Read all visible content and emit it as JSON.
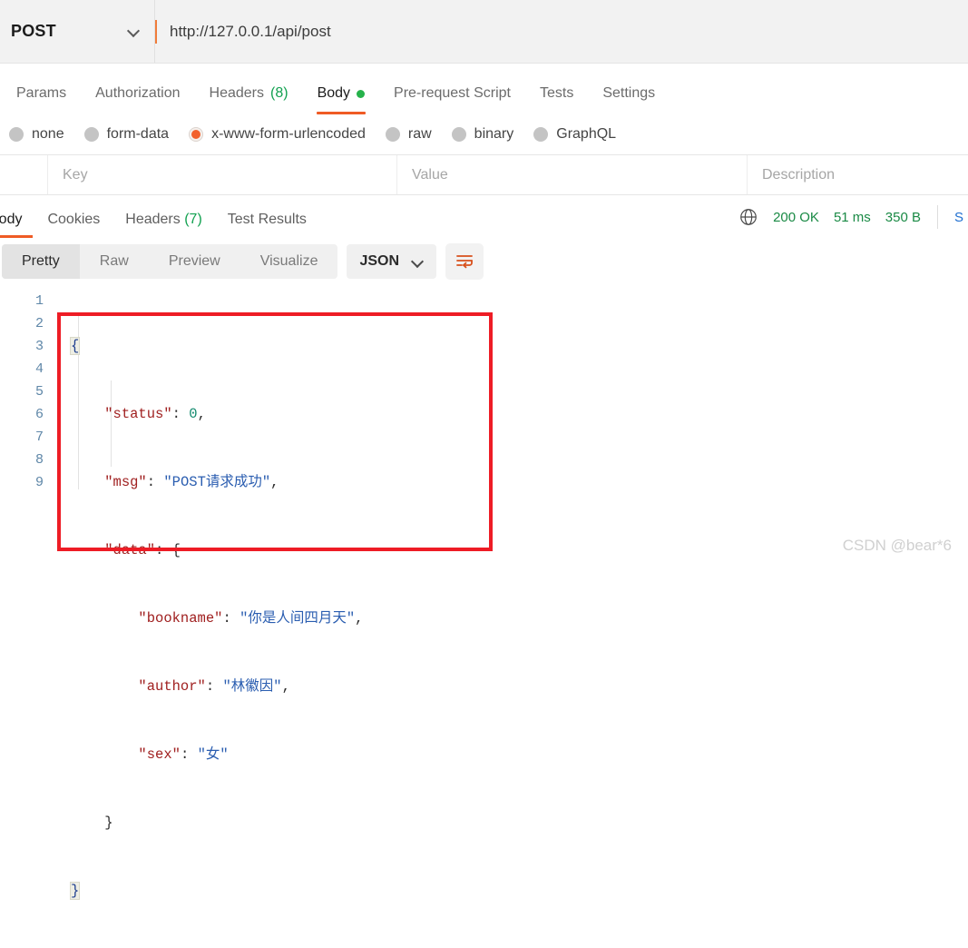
{
  "request_bar": {
    "method": "POST",
    "method_icon": "chevron-down-icon",
    "url": "http://127.0.0.1/api/post"
  },
  "request_tabs": [
    {
      "label": "Params",
      "active": false,
      "count": ""
    },
    {
      "label": "Authorization",
      "active": false,
      "count": ""
    },
    {
      "label": "Headers",
      "active": false,
      "count": "(8)"
    },
    {
      "label": "Body",
      "active": true,
      "count": ""
    },
    {
      "label": "Pre-request Script",
      "active": false,
      "count": ""
    },
    {
      "label": "Tests",
      "active": false,
      "count": ""
    },
    {
      "label": "Settings",
      "active": false,
      "count": ""
    }
  ],
  "body_types": [
    {
      "label": "none",
      "checked": false
    },
    {
      "label": "form-data",
      "checked": false
    },
    {
      "label": "x-www-form-urlencoded",
      "checked": true
    },
    {
      "label": "raw",
      "checked": false
    },
    {
      "label": "binary",
      "checked": false
    },
    {
      "label": "GraphQL",
      "checked": false
    }
  ],
  "param_table": {
    "columns": [
      "Key",
      "Value",
      "Description"
    ],
    "rows": []
  },
  "response_tabs": [
    {
      "label": "Body",
      "active": true,
      "count": ""
    },
    {
      "label": "Cookies",
      "active": false,
      "count": ""
    },
    {
      "label": "Headers",
      "active": false,
      "count": "(7)"
    },
    {
      "label": "Test Results",
      "active": false,
      "count": ""
    }
  ],
  "response_status": {
    "globe_icon": "globe-icon",
    "status": "200 OK",
    "time": "51 ms",
    "size": "350 B",
    "save_response": "S"
  },
  "view_toolbar": {
    "views": [
      {
        "label": "Pretty",
        "active": true
      },
      {
        "label": "Raw",
        "active": false
      },
      {
        "label": "Preview",
        "active": false
      },
      {
        "label": "Visualize",
        "active": false
      }
    ],
    "format": "JSON",
    "format_icon": "chevron-down-icon",
    "wrap_icon": "word-wrap-icon"
  },
  "code": {
    "line_numbers": [
      "1",
      "2",
      "3",
      "4",
      "5",
      "6",
      "7",
      "8",
      "9"
    ],
    "lines": [
      "{",
      "    \"status\": 0,",
      "    \"msg\": \"POST请求成功\",",
      "    \"data\": {",
      "        \"bookname\": \"你是人间四月天\",",
      "        \"author\": \"林徽因\",",
      "        \"sex\": \"女\"",
      "    }",
      "}"
    ],
    "parsed": {
      "status": 0,
      "msg": "POST请求成功",
      "data": {
        "bookname": "你是人间四月天",
        "author": "林徽因",
        "sex": "女"
      }
    }
  },
  "colors": {
    "accent": "#ef5b25",
    "annotation": "#ee1c25",
    "status_green": "#1a8a45",
    "json_key": "#a02020",
    "json_string": "#2a5db0",
    "json_number": "#128a6e"
  },
  "watermark": "CSDN @bear*6"
}
